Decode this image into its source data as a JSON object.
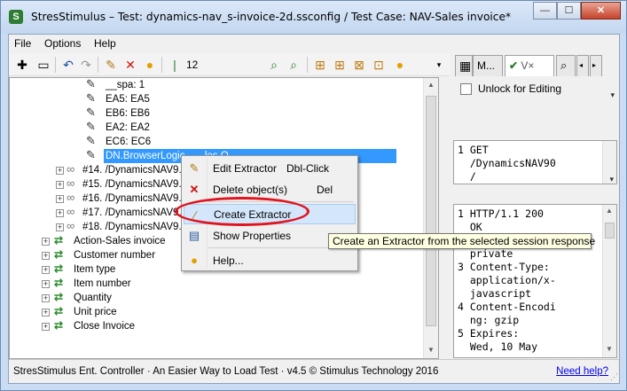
{
  "window": {
    "title": "StresStimulus – Test: dynamics-nav_s-invoice-2d.ssconfig / Test Case: NAV-Sales invoice*",
    "app_icon": "S",
    "minimize_glyph": "—",
    "maximize_glyph": "☐",
    "close_glyph": "✕"
  },
  "menu": {
    "file": "File",
    "options": "Options",
    "help": "Help"
  },
  "toolbar": {
    "number": "12"
  },
  "tree": {
    "items": [
      {
        "text": "__spa: 1"
      },
      {
        "text": "EA5: EA5"
      },
      {
        "text": "EB6: EB6"
      },
      {
        "text": "EA2: EA2"
      },
      {
        "text": "EC6: EC6"
      },
      {
        "text": "DN.BrowserLogic... ...les O..."
      },
      {
        "text": "#14. /DynamicsNAV9... ...rosoft.Dy..."
      },
      {
        "text": "#15. /DynamicsNAV9... ...NAV-Symbo..."
      },
      {
        "text": "#16. /DynamicsNAV9... ...ouette.sv..."
      },
      {
        "text": "#17. /DynamicsNAV9... ...0YV-_8yWuh..."
      },
      {
        "text": "#18. /DynamicsNAV9..."
      },
      {
        "text": "Action-Sales invoice"
      },
      {
        "text": "Customer number"
      },
      {
        "text": "Item type"
      },
      {
        "text": "Item number"
      },
      {
        "text": "Quantity"
      },
      {
        "text": "Unit price"
      },
      {
        "text": "Close Invoice"
      }
    ]
  },
  "right_pane": {
    "tab_m": "M...",
    "tab_vx": "V×",
    "unlock_label": "Unlock for Editing",
    "request_lines": "1 GET\n  /DynamicsNAV90\n  /",
    "response_lines": "1 HTTP/1.1 200\n  OK\n2 Cache-Control:\n  private\n3 Content-Type:\n  application/x-\n  javascript\n4 Content-Encodi\n  ng: gzip\n5 Expires:\n  Wed, 10 May"
  },
  "context_menu": {
    "items": [
      {
        "label": "Edit Extractor",
        "shortcut": "Dbl-Click",
        "icon": "pencil-icon"
      },
      {
        "label": "Delete object(s)",
        "shortcut": "Del",
        "icon": "delete-x-icon"
      },
      {
        "label": "Create Extractor",
        "shortcut": "",
        "icon": "wand-icon"
      },
      {
        "label": "Show Properties",
        "shortcut": "",
        "icon": "properties-icon"
      },
      {
        "label": "Help...",
        "shortcut": "",
        "icon": "lightbulb-icon"
      }
    ]
  },
  "tooltip": "Create an Extractor from the selected session response",
  "status": {
    "text": "StresStimulus Ent. Controller · An Easier Way to Load Test · v4.5 © Stimulus Technology 2016",
    "need_help": "Need help?"
  },
  "colors": {
    "selection": "#3399ff",
    "highlight_oval": "#e0141e",
    "tooltip_bg": "#ffffe1"
  }
}
